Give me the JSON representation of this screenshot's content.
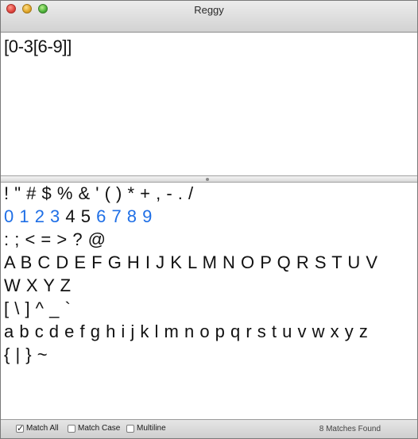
{
  "window": {
    "title": "Reggy"
  },
  "regex": {
    "pattern": "[0-3[6-9]]"
  },
  "text_lines": [
    {
      "segments": [
        {
          "text": "! \" # $ % & ' ( ) * + , - . /",
          "match": false
        }
      ]
    },
    {
      "segments": [
        {
          "text": "0 1 2 3",
          "match": true
        },
        {
          "text": " 4 5 ",
          "match": false
        },
        {
          "text": "6 7 8 9",
          "match": true
        }
      ]
    },
    {
      "segments": [
        {
          "text": ": ; < = > ? @",
          "match": false
        }
      ]
    },
    {
      "segments": [
        {
          "text": "A B C D E F G H I J K L M N O P Q R S T U V",
          "match": false
        }
      ]
    },
    {
      "segments": [
        {
          "text": "W X Y Z",
          "match": false
        }
      ]
    },
    {
      "segments": [
        {
          "text": "[ \\ ] ^ _ `",
          "match": false
        }
      ]
    },
    {
      "segments": [
        {
          "text": "a b c d e f g h i j k l m n o p q r s t u v w x y z",
          "match": false
        }
      ]
    },
    {
      "segments": [
        {
          "text": "{ | } ~",
          "match": false
        }
      ]
    }
  ],
  "colors": {
    "match": "#1f6fe6"
  },
  "options": {
    "match_all": {
      "label": "Match All",
      "checked": true
    },
    "match_case": {
      "label": "Match Case",
      "checked": false
    },
    "multiline": {
      "label": "Multiline",
      "checked": false
    }
  },
  "status": {
    "matches": "8 Matches Found"
  }
}
